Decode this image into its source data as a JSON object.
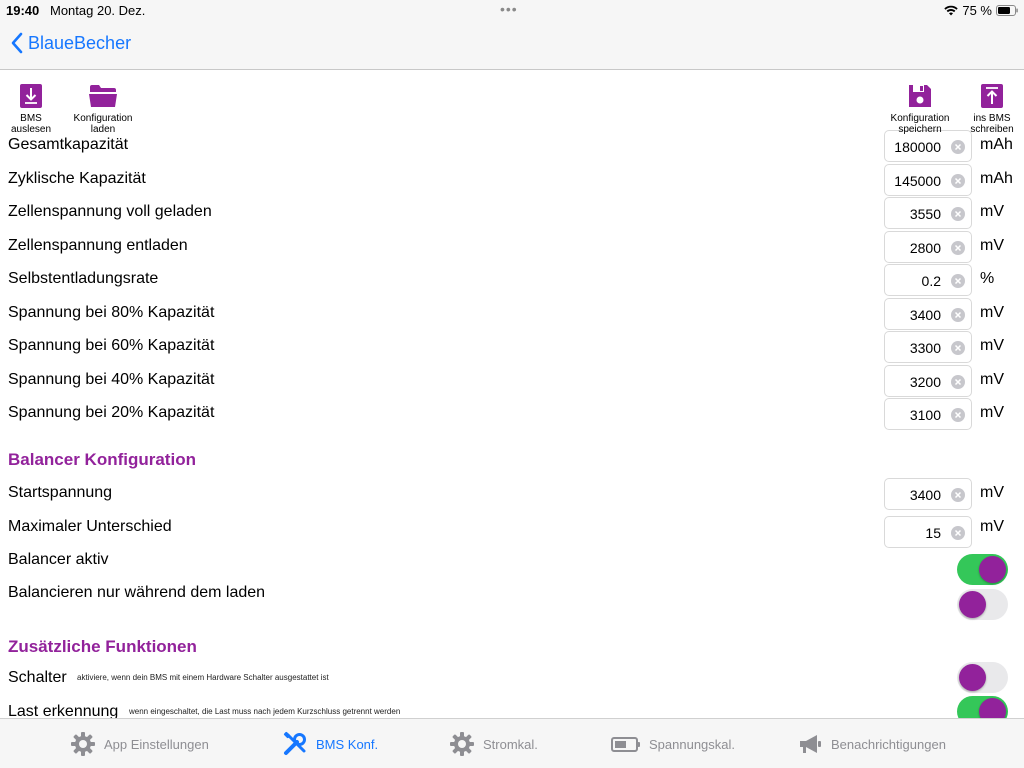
{
  "status": {
    "time": "19:40",
    "date": "Montag 20. Dez.",
    "battery": "75 %"
  },
  "nav": {
    "back_label": "BlaueBecher"
  },
  "toolbar": {
    "read_bms": "BMS\nauslesen",
    "load_config": "Konfiguration\nladen",
    "save_config": "Konfiguration\nspeichern",
    "write_bms": "ins BMS\nschreiben"
  },
  "capacity_rows": [
    {
      "label": "Gesamtkapazität",
      "value": "180000",
      "unit": "mAh"
    },
    {
      "label": "Zyklische Kapazität",
      "value": "145000",
      "unit": "mAh"
    },
    {
      "label": "Zellenspannung voll geladen",
      "value": "3550",
      "unit": "mV"
    },
    {
      "label": "Zellenspannung entladen",
      "value": "2800",
      "unit": "mV"
    },
    {
      "label": "Selbstentladungsrate",
      "value": "0.2",
      "unit": "%"
    },
    {
      "label": "Spannung bei 80% Kapazität",
      "value": "3400",
      "unit": "mV"
    },
    {
      "label": "Spannung bei 60% Kapazität",
      "value": "3300",
      "unit": "mV"
    },
    {
      "label": "Spannung bei 40% Kapazität",
      "value": "3200",
      "unit": "mV"
    },
    {
      "label": "Spannung bei 20% Kapazität",
      "value": "3100",
      "unit": "mV"
    }
  ],
  "balancer": {
    "title": "Balancer Konfiguration",
    "start": {
      "label": "Startspannung",
      "value": "3400",
      "unit": "mV"
    },
    "max_diff": {
      "label": "Maximaler Unterschied",
      "value": "15",
      "unit": "mV"
    },
    "active": {
      "label": "Balancer aktiv",
      "on": true
    },
    "charge_only": {
      "label": "Balancieren nur während dem laden",
      "on": false
    }
  },
  "extra": {
    "title": "Zusätzliche Funktionen",
    "switch": {
      "label": "Schalter",
      "hint": "aktiviere, wenn dein BMS mit einem Hardware Schalter ausgestattet ist",
      "on": false
    },
    "load_detect": {
      "label": "Last erkennung",
      "hint": "wenn eingeschaltet, die Last muss nach jedem Kurzschluss getrennt werden",
      "on": true
    }
  },
  "tabs": {
    "app_settings": "App Einstellungen",
    "bms_config": "BMS Konf.",
    "current_cal": "Stromkal.",
    "voltage_cal": "Spannungskal.",
    "notifications": "Benachrichtigungen"
  },
  "colors": {
    "accent": "#92229b",
    "ios_blue": "#1677ff",
    "toggle_on": "#34c759"
  },
  "icons": {
    "read_bms": "download-icon",
    "load_config": "folder-icon",
    "save_config": "floppy-disk-icon",
    "write_bms": "upload-icon",
    "app_settings": "gear-icon",
    "bms_config": "wrench-screwdriver-icon",
    "current_cal": "gear-icon",
    "voltage_cal": "battery-icon",
    "notifications": "megaphone-icon"
  }
}
